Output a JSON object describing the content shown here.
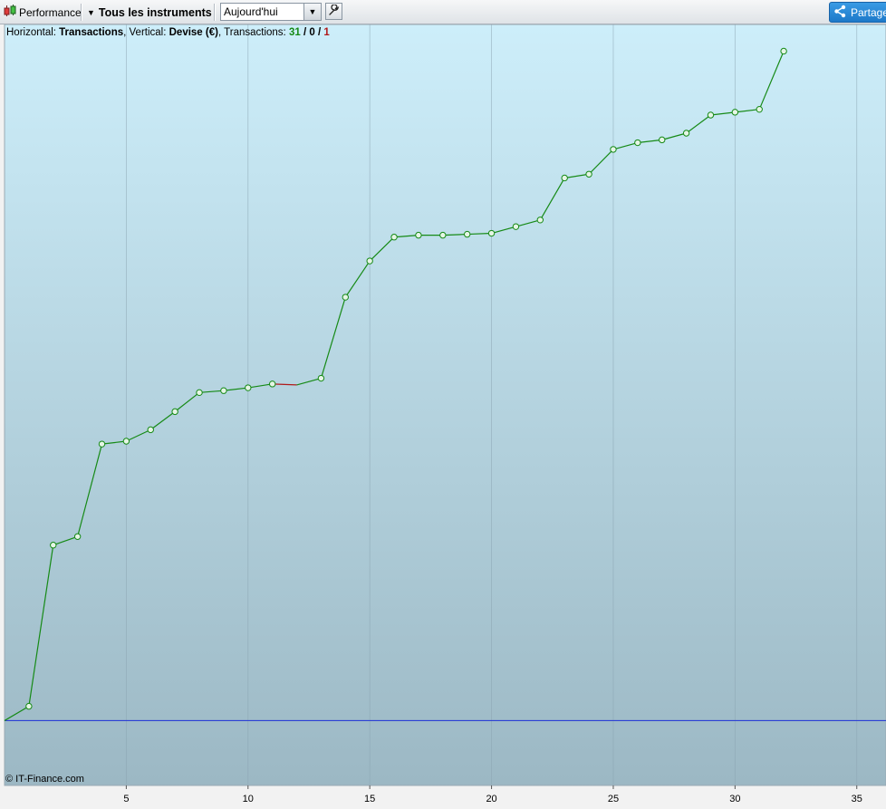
{
  "toolbar": {
    "performance_label": "Performance",
    "instruments_label": "Tous les instruments",
    "period_value": "Aujourd'hui",
    "share_label": "Partager",
    "icons": {
      "performance": "candlestick-icon",
      "instruments": "triangle-down-icon",
      "period": "chevron-down-icon",
      "settings": "wrench-icon",
      "share": "share-icon"
    }
  },
  "info": {
    "horizontal_prefix": "Horizontal: ",
    "horizontal_value": "Transactions",
    "vertical_prefix": ", Vertical: ",
    "vertical_value": "Devise (€)",
    "transactions_prefix": ", Transactions: ",
    "winning": "31",
    "sep1": " / ",
    "neutral": "0",
    "sep2": " / ",
    "losing": "1"
  },
  "copyright": "© IT-Finance.com",
  "colors": {
    "winning": "#168a16",
    "losing": "#b01a1a",
    "zero_line": "#1c2fd6",
    "bg_top": "#cdeefa",
    "bg_bottom": "#9cb8c4",
    "grid": "#8aa4b0"
  },
  "chart_data": {
    "type": "line",
    "xlabel": "",
    "ylabel": "",
    "title": "",
    "x_ticks": [
      5,
      10,
      15,
      20,
      25,
      30,
      35
    ],
    "xlim": [
      0,
      36.2
    ],
    "grid": true,
    "x": [
      0,
      1,
      2,
      3,
      4,
      5,
      6,
      7,
      8,
      9,
      10,
      11,
      12,
      13,
      14,
      15,
      16,
      17,
      18,
      19,
      20,
      21,
      22,
      23,
      24,
      25,
      26,
      27,
      28,
      29,
      30,
      31,
      32
    ],
    "values": [
      0,
      15,
      184,
      193,
      290,
      293,
      305,
      324,
      344,
      346,
      349,
      353,
      352,
      359,
      444,
      482,
      507,
      509,
      509,
      510,
      511,
      518,
      525,
      569,
      573,
      599,
      606,
      609,
      616,
      635,
      638,
      641,
      702
    ],
    "ylim": [
      -68,
      730
    ],
    "losing_segments": [
      [
        11,
        12
      ]
    ]
  }
}
